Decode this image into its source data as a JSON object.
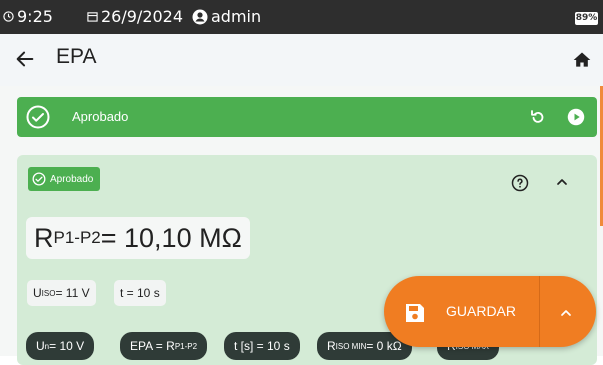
{
  "status_bar": {
    "time": "9:25",
    "date": "26/9/2024",
    "user": "admin",
    "battery": "89%"
  },
  "app_bar": {
    "title": "EPA"
  },
  "result_banner": {
    "label": "Aprobado"
  },
  "card": {
    "badge": "Aprobado",
    "result": {
      "symbol": "R",
      "sub": "P1-P2",
      "value": " = 10,10 MΩ"
    },
    "params": [
      {
        "sym": "U",
        "sub": "ISO",
        "val": " = 11 V"
      },
      {
        "sym": "",
        "sub": "",
        "val": "t = 10 s"
      }
    ],
    "chips": [
      {
        "sym": "U",
        "sub": "n",
        "val": " = 10 V"
      },
      {
        "sym": "EPA = R",
        "sub": "P1-P2",
        "val": ""
      },
      {
        "sym": "t [s] = 10 s",
        "sub": "",
        "val": ""
      },
      {
        "sym": "R",
        "sub": "ISO MIN",
        "val": " = 0 kΩ"
      },
      {
        "sym": "R",
        "sub": "ISO MAX",
        "val": ""
      }
    ]
  },
  "fab": {
    "save_label": "GUARDAR"
  },
  "colors": {
    "success": "#4caf50",
    "card_bg": "#d4ebd6",
    "accent": "#f07d22",
    "chip": "#2f3b37",
    "status_bar": "#2e2e2e"
  }
}
